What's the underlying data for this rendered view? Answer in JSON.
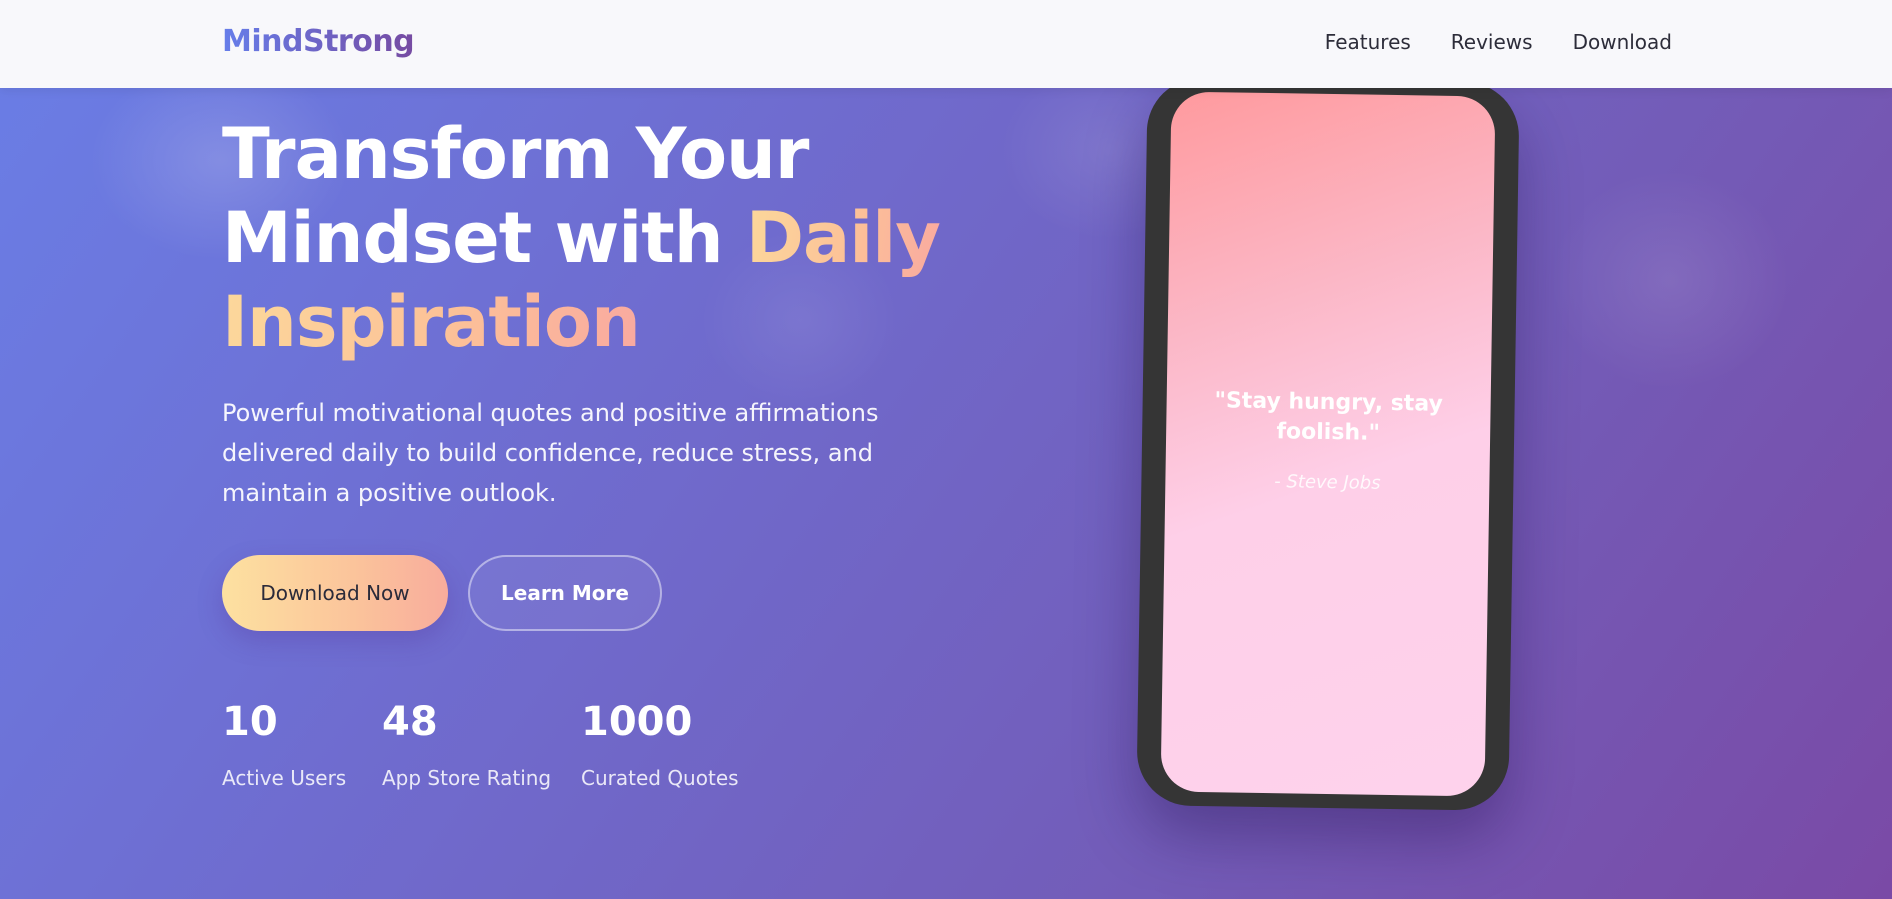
{
  "nav": {
    "logo": "MindStrong",
    "links": [
      "Features",
      "Reviews",
      "Download"
    ]
  },
  "hero": {
    "title_line1": "Transform Your",
    "title_line2_plain": "Mindset with ",
    "title_line2_accent": "Daily",
    "title_line3_accent": "Inspiration",
    "subtitle": "Powerful motivational quotes and positive affirmations delivered daily to build confidence, reduce stress, and maintain a positive outlook.",
    "primary_button": "Download Now",
    "secondary_button": "Learn More"
  },
  "stats": [
    {
      "value": "10",
      "label": "Active Users"
    },
    {
      "value": "48",
      "label": "App Store Rating"
    },
    {
      "value": "1000",
      "label": "Curated Quotes"
    }
  ],
  "phone": {
    "quote": "\"Stay hungry, stay foolish.\"",
    "author": "- Steve Jobs"
  },
  "colors": {
    "brand_gradient_start": "#667eea",
    "brand_gradient_end": "#764ba2",
    "accent_yellow": "#fcd89b",
    "accent_peach": "#f9a9a0",
    "phone_frame": "#353535"
  }
}
